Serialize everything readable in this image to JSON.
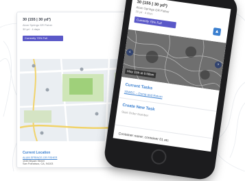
{
  "web_card": {
    "title": "30 (155 | 30 yd³)",
    "subtitle": "Alum Springs GR Fisher",
    "meta": "30 yd · 4 days",
    "status_badge": "Currently 70% Full",
    "view_button": "View"
  },
  "location": {
    "heading": "Current Location",
    "name": "ALUM SPRINGS GR FISHER",
    "address_line1": "1045 Bryant Street",
    "address_line2": "San Francisco, CA, 94103"
  },
  "phone": {
    "title": "30 (155 | 30 yd³)",
    "subtitle": "Alum Springs GR Fisher",
    "meta": "30 yd · 4 days",
    "status_badge": "Currently 70% Full",
    "photo_date": "May 11th at 6:58am",
    "current_tasks_heading": "Current Tasks",
    "task_link": "30WEC – Dump and Return",
    "create_task_heading": "Create New Task",
    "create_task_text": "Start Order Number",
    "footer_text": "Container name: container 01 etc"
  },
  "colors": {
    "accent_blue": "#3a7fcf",
    "badge_purple": "#5a58c8"
  }
}
